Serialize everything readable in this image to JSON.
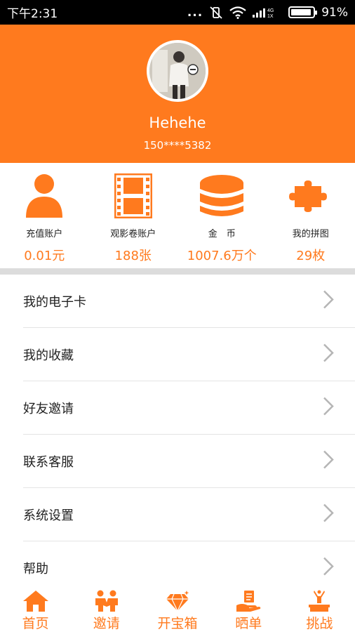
{
  "status_bar": {
    "time": "下午2:31",
    "dots": "...",
    "network_label": "4G 1X",
    "battery_percent": "91%",
    "battery_level": 0.91
  },
  "profile": {
    "username": "Hehehe",
    "phone": "150****5382"
  },
  "accounts": [
    {
      "icon": "person-icon",
      "label": "充值账户",
      "value": "0.01元"
    },
    {
      "icon": "film-icon",
      "label": "观影卷账户",
      "value": "188张"
    },
    {
      "icon": "coin-stack-icon",
      "label": "金　币",
      "value": "1007.6万个"
    },
    {
      "icon": "puzzle-icon",
      "label": "我的拼图",
      "value": "29枚"
    }
  ],
  "menu": [
    {
      "label": "我的电子卡"
    },
    {
      "label": "我的收藏"
    },
    {
      "label": "好友邀请"
    },
    {
      "label": "联系客服"
    },
    {
      "label": "系统设置"
    },
    {
      "label": "帮助"
    }
  ],
  "tabs": [
    {
      "icon": "home-icon",
      "label": "首页"
    },
    {
      "icon": "invite-icon",
      "label": "邀请"
    },
    {
      "icon": "diamond-icon",
      "label": "开宝箱"
    },
    {
      "icon": "receipt-hand-icon",
      "label": "晒单"
    },
    {
      "icon": "trophy-podium-icon",
      "label": "挑战"
    }
  ],
  "colors": {
    "accent": "#ff7a1e",
    "status_bar": "#000000",
    "separator": "#dcdcdc",
    "chevron": "#b5b5b5"
  }
}
